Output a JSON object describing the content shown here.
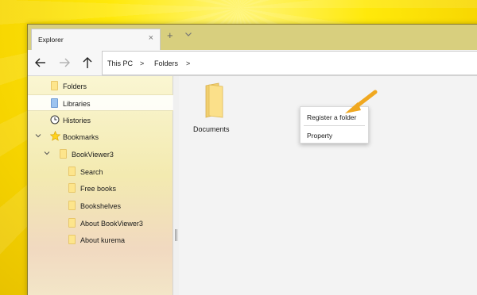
{
  "window": {
    "tab_title": "Explorer",
    "tab_close": "×",
    "tab_add": "+"
  },
  "breadcrumb": [
    {
      "label": "This PC",
      "sep": ">"
    },
    {
      "label": "Folders",
      "sep": ">"
    }
  ],
  "sidebar": {
    "items": [
      {
        "label": "Folders",
        "icon": "folder-icon"
      },
      {
        "label": "Libraries",
        "icon": "library-icon",
        "selected": true
      },
      {
        "label": "Histories",
        "icon": "clock-icon"
      },
      {
        "label": "Bookmarks",
        "icon": "star-icon",
        "expanded": true
      },
      {
        "label": "BookViewer3",
        "icon": "folder-icon",
        "expanded": true
      },
      {
        "label": "Search",
        "icon": "folder-icon"
      },
      {
        "label": "Free books",
        "icon": "folder-icon"
      },
      {
        "label": "Bookshelves",
        "icon": "folder-icon"
      },
      {
        "label": "About BookViewer3",
        "icon": "folder-icon"
      },
      {
        "label": "About kurema",
        "icon": "folder-icon"
      }
    ]
  },
  "content": {
    "items": [
      {
        "label": "Documents",
        "icon": "folder-icon"
      }
    ]
  },
  "context_menu": {
    "items": [
      {
        "label": "Register a folder"
      },
      {
        "label": "Property"
      }
    ]
  },
  "colors": {
    "background_accent": "#ffe90a",
    "titlebar": "#d8cf7e",
    "folder": "#fde58c",
    "library": "#9cc3ef",
    "arrow": "#f0a820"
  }
}
